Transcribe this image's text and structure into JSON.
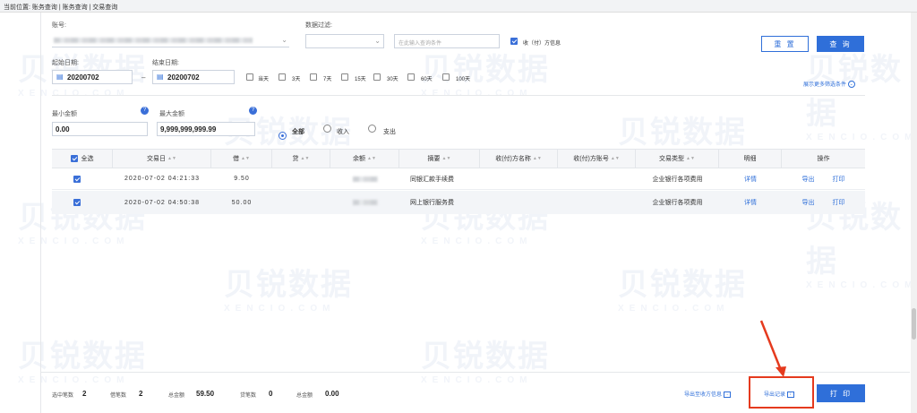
{
  "breadcrumb": "当前位置: 账务查询 | 账务查询 | 交易查询",
  "filters": {
    "account_label": "账号:",
    "data_filter_label": "数据过滤:",
    "search_placeholder": "在此输入查询条件",
    "counterparty_info_label": "收（付）方信息",
    "start_date_label": "起始日期:",
    "start_date": "20200702",
    "end_date_label": "结束日期:",
    "end_date": "20200702",
    "date_sep": "–",
    "quick_ranges": [
      "当天",
      "3天",
      "7天",
      "15天",
      "30天",
      "60天",
      "100天"
    ],
    "more_filters": "展示更多筛选条件",
    "min_amount_label": "最小金额",
    "min_amount": "0.00",
    "max_amount_label": "最大金额",
    "max_amount": "9,999,999,999.99",
    "direction_options": [
      "全部",
      "收入",
      "支出"
    ],
    "reset_label": "重 置",
    "query_label": "查 询"
  },
  "table": {
    "select_all": "全选",
    "headers": [
      "交易日",
      "借",
      "贷",
      "余额",
      "摘要",
      "收(付)方名称",
      "收(付)方账号",
      "交易类型",
      "明细",
      "操作"
    ],
    "rows": [
      {
        "date": "2020-07-02 04:21:33",
        "debit": "9.50",
        "credit": "",
        "summary": "同银汇款手续费",
        "type": "企业银行各项费用",
        "detail": "详情",
        "export": "导出",
        "print": "打印"
      },
      {
        "date": "2020-07-02 04:50:38",
        "debit": "50.00",
        "credit": "",
        "summary": "网上银行服务费",
        "type": "企业银行各项费用",
        "detail": "详情",
        "export": "导出",
        "print": "打印"
      }
    ]
  },
  "footer": {
    "selected_count_label": "选中笔数",
    "selected_count": "2",
    "debit_count_label": "借笔数",
    "debit_count": "2",
    "total_debit_label": "总金额",
    "total_debit": "59.50",
    "credit_count_label": "贷笔数",
    "credit_count": "0",
    "total_credit_label": "总金额",
    "total_credit": "0.00",
    "export_counterparty": "导出至收方信息",
    "export_records": "导出记录",
    "print_label": "打 印"
  },
  "watermark": {
    "text": "贝锐数据",
    "sub": "XENCIO.COM"
  },
  "colors": {
    "accent": "#2f6fd9",
    "annotation": "#e53a1e"
  }
}
